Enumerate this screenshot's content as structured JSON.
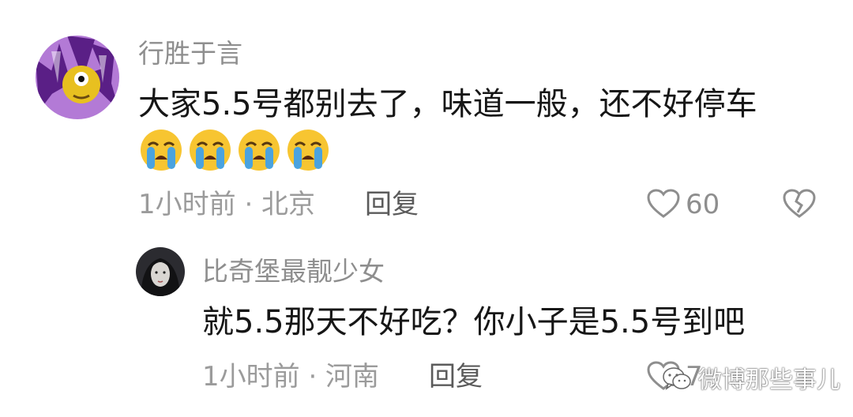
{
  "comment": {
    "username": "行胜于言",
    "text": "大家5.5号都别去了，味道一般，还不好停车",
    "emojis": [
      "loudly-crying-face",
      "loudly-crying-face",
      "loudly-crying-face",
      "loudly-crying-face"
    ],
    "meta": "1小时前 · 北京",
    "reply_label": "回复",
    "like_count": "60",
    "icons": {
      "like": "heart-outline-icon",
      "dislike": "broken-heart-icon"
    }
  },
  "reply": {
    "username": "比奇堡最靓少女",
    "text": "就5.5那天不好吃？你小子是5.5号到吧",
    "meta": "1小时前 · 河南",
    "reply_label": "回复",
    "like_count": "7",
    "icons": {
      "like": "heart-outline-icon"
    }
  },
  "watermark": {
    "text": "微博那些事儿",
    "icon": "wechat-icon"
  },
  "colors": {
    "text_primary": "#161616",
    "username": "#8e8e8e",
    "meta": "#9b9b9b",
    "reply": "#5b5b5b"
  }
}
